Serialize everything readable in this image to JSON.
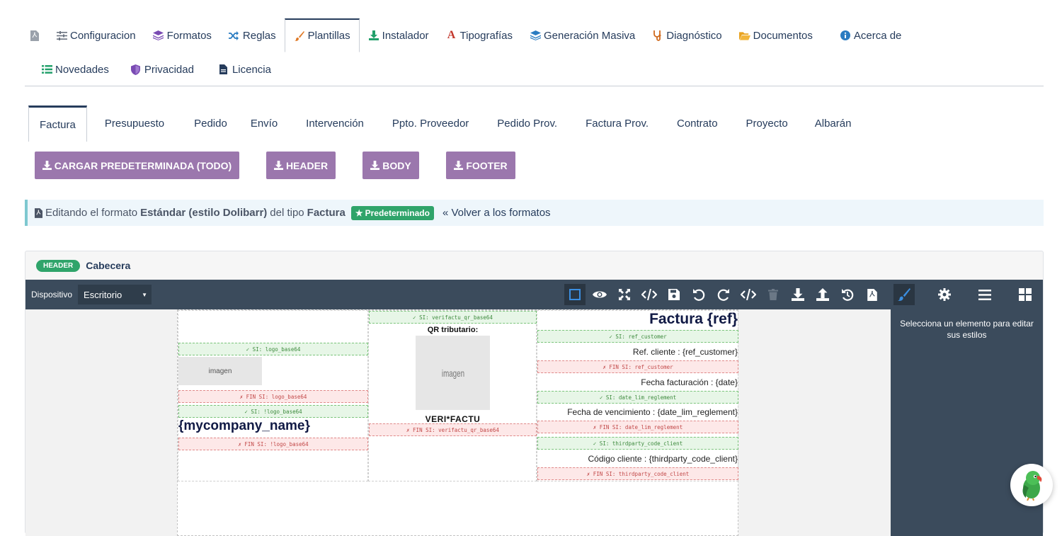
{
  "nav": {
    "row1": [
      {
        "label": "",
        "icon": "pdf-file-icon"
      },
      {
        "label": "Configuracion",
        "icon": "sliders-icon"
      },
      {
        "label": "Formatos",
        "icon": "layers-icon"
      },
      {
        "label": "Reglas",
        "icon": "shuffle-icon"
      },
      {
        "label": "Plantillas",
        "icon": "paintbrush-icon"
      },
      {
        "label": "Instalador",
        "icon": "download-icon"
      },
      {
        "label": "Tipografías",
        "icon": "font-icon"
      },
      {
        "label": "Generación Masiva",
        "icon": "layers-icon"
      },
      {
        "label": "Diagnóstico",
        "icon": "stethoscope-icon"
      },
      {
        "label": "Documentos",
        "icon": "folder-open-icon"
      },
      {
        "label": "Acerca de",
        "icon": "info-circle-icon"
      }
    ],
    "row2": [
      {
        "label": "Novedades",
        "icon": "list-icon"
      },
      {
        "label": "Privacidad",
        "icon": "shield-icon"
      },
      {
        "label": "Licencia",
        "icon": "file-text-icon"
      }
    ],
    "active": "Plantillas"
  },
  "doc_tabs": [
    "Factura",
    "Presupuesto",
    "Pedido",
    "Envío",
    "Intervención",
    "Ppto. Proveedor",
    "Pedido Prov.",
    "Factura Prov.",
    "Contrato",
    "Proyecto",
    "Albarán"
  ],
  "buttons": {
    "load_default": "CARGAR PREDETERMINADA (TODO)",
    "header": "HEADER",
    "body": "BODY",
    "footer": "FOOTER"
  },
  "info": {
    "prefix": "Editando el formato",
    "format_name": "Estándar (estilo Dolibarr)",
    "middle": "del tipo",
    "type_name": "Factura",
    "badge": "Predeterminado",
    "back": "« Volver a los formatos"
  },
  "section": {
    "badge": "HEADER",
    "title": "Cabecera"
  },
  "toolbar": {
    "device_label": "Dispositivo",
    "device_value": "Escritorio",
    "icons": [
      "square-outline-icon",
      "eye-icon",
      "fullscreen-icon",
      "code-icon",
      "save-icon",
      "undo-icon",
      "redo-icon",
      "code-icon",
      "trash-icon",
      "download-icon",
      "upload-icon",
      "history-icon",
      "pdf-file-icon",
      "paintbrush-icon",
      "gear-icon",
      "menu-icon",
      "grid-icon"
    ]
  },
  "right_panel": {
    "hint": "Selecciona un elemento para editar sus estilos"
  },
  "canvas": {
    "left": {
      "si_logo": "✓ SI: logo_base64",
      "img1": "imagen",
      "fin_logo": "✗ FIN SI: logo_base64",
      "si_nologo": "✓ SI: !logo_base64",
      "company": "{mycompany_name}",
      "fin_nologo": "✗ FIN SI: !logo_base64"
    },
    "middle": {
      "si_qr": "✓ SI: verifactu_qr_base64",
      "qr_title": "QR tributario:",
      "img2": "imagen",
      "verifactu": "VERI*FACTU",
      "fin_qr": "✗ FIN SI: verifactu_qr_base64"
    },
    "right": {
      "title": "Factura {ref}",
      "si_ref": "✓ SI: ref_customer",
      "ref_line": "Ref. cliente : {ref_customer}",
      "fin_ref": "✗ FIN SI: ref_customer",
      "date_line": "Fecha facturación : {date}",
      "si_lim": "✓ SI: date_lim_reglement",
      "lim_line": "Fecha de vencimiento : {date_lim_reglement}",
      "fin_lim": "✗ FIN SI: date_lim_reglement",
      "si_code": "✓ SI: thirdparty_code_client",
      "code_line": "Código cliente : {thirdparty_code_client}",
      "fin_code": "✗ FIN SI: thirdparty_code_client"
    }
  },
  "colors": {
    "nav_text": "#263c5c",
    "button_purple": "#9b77ad",
    "badge_green": "#2fa46a",
    "toolbar": "#3b4b5c"
  }
}
